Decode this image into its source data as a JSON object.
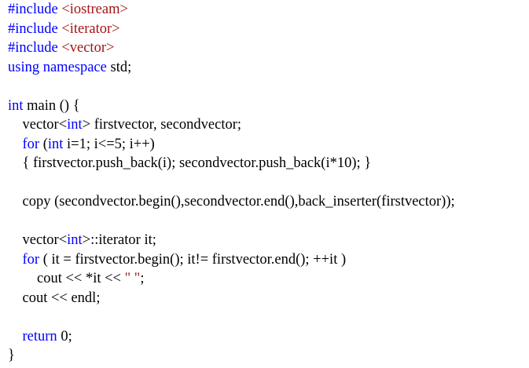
{
  "colors": {
    "keyword": "#0000ff",
    "string": "#a31515",
    "plain": "#000000"
  },
  "lines": [
    [
      {
        "t": "#include ",
        "c": "keyword"
      },
      {
        "t": "<iostream>",
        "c": "string"
      }
    ],
    [
      {
        "t": "#include ",
        "c": "keyword"
      },
      {
        "t": "<iterator>",
        "c": "string"
      }
    ],
    [
      {
        "t": "#include ",
        "c": "keyword"
      },
      {
        "t": "<vector>",
        "c": "string"
      }
    ],
    [
      {
        "t": "using namespace",
        "c": "keyword"
      },
      {
        "t": " std;",
        "c": "plain"
      }
    ],
    [],
    [
      {
        "t": "int",
        "c": "keyword"
      },
      {
        "t": " main () {",
        "c": "plain"
      }
    ],
    [
      {
        "t": "    vector<",
        "c": "plain"
      },
      {
        "t": "int",
        "c": "keyword"
      },
      {
        "t": "> firstvector, secondvector;",
        "c": "plain"
      }
    ],
    [
      {
        "t": "    ",
        "c": "plain"
      },
      {
        "t": "for",
        "c": "keyword"
      },
      {
        "t": " (",
        "c": "plain"
      },
      {
        "t": "int",
        "c": "keyword"
      },
      {
        "t": " i=1; i<=5; i++)",
        "c": "plain"
      }
    ],
    [
      {
        "t": "    { firstvector.push_back(i); secondvector.push_back(i*10); }",
        "c": "plain"
      }
    ],
    [],
    [
      {
        "t": "    copy (secondvector.begin(),secondvector.end(),back_inserter(firstvector));",
        "c": "plain"
      }
    ],
    [],
    [
      {
        "t": "    vector<",
        "c": "plain"
      },
      {
        "t": "int",
        "c": "keyword"
      },
      {
        "t": ">::iterator it;",
        "c": "plain"
      }
    ],
    [
      {
        "t": "    ",
        "c": "plain"
      },
      {
        "t": "for",
        "c": "keyword"
      },
      {
        "t": " ( it = firstvector.begin(); it!= firstvector.end(); ++it )",
        "c": "plain"
      }
    ],
    [
      {
        "t": "        cout << *it << ",
        "c": "plain"
      },
      {
        "t": "\" \"",
        "c": "string"
      },
      {
        "t": ";",
        "c": "plain"
      }
    ],
    [
      {
        "t": "    cout << endl;",
        "c": "plain"
      }
    ],
    [],
    [
      {
        "t": "    ",
        "c": "plain"
      },
      {
        "t": "return",
        "c": "keyword"
      },
      {
        "t": " 0;",
        "c": "plain"
      }
    ],
    [
      {
        "t": "}",
        "c": "plain"
      }
    ]
  ]
}
